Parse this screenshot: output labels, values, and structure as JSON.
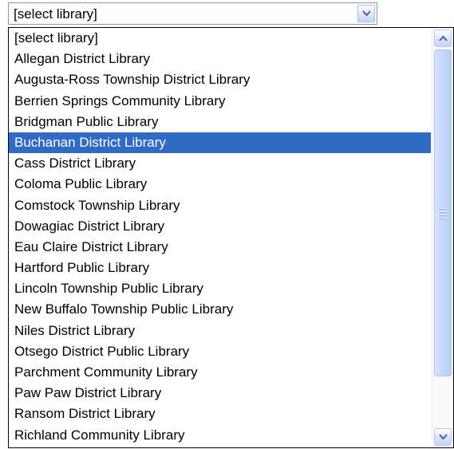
{
  "select": {
    "value": "[select library]"
  },
  "dropdown": {
    "selected_index": 5,
    "items": [
      "[select library]",
      "Allegan District Library",
      "Augusta-Ross Township District Library",
      "Berrien Springs Community Library",
      "Bridgman Public Library",
      "Buchanan District Library",
      "Cass District Library",
      "Coloma Public Library",
      "Comstock Township Library",
      "Dowagiac District Library",
      "Eau Claire District Library",
      "Hartford Public Library",
      "Lincoln Township Public Library",
      "New Buffalo Township Public Library",
      "Niles District Library",
      "Otsego District Public Library",
      "Parchment Community Library",
      "Paw Paw District Library",
      "Ransom District Library",
      "Richland Community Library"
    ]
  },
  "icons": {
    "dropdown_arrow": "chevron-down-icon",
    "scroll_up": "chevron-up-icon",
    "scroll_down": "chevron-down-icon",
    "thumb_grip": "grip-icon"
  },
  "colors": {
    "selection_bg": "#316ac5",
    "selection_text": "#ffffff",
    "border": "#7f9db9"
  }
}
